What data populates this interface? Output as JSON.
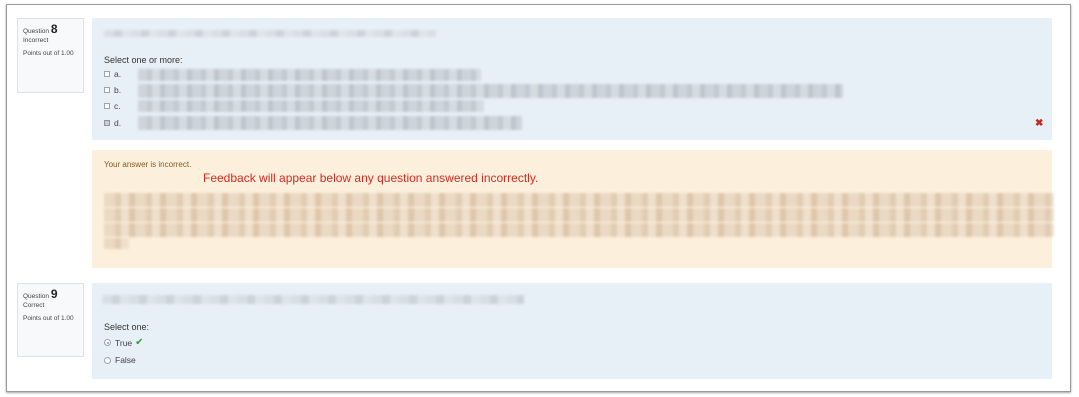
{
  "questions": [
    {
      "number_label": "Question",
      "number": "8",
      "status": "Incorrect",
      "points": "Points out of 1.00",
      "prompt": "Select one or more:",
      "options": [
        {
          "letter": "a.",
          "checked": false
        },
        {
          "letter": "b.",
          "checked": false
        },
        {
          "letter": "c.",
          "checked": false
        },
        {
          "letter": "d.",
          "checked": true
        }
      ],
      "result_icon": "x-icon",
      "feedback": {
        "heading": "Your answer is incorrect.",
        "note": "Feedback will appear below any question answered incorrectly."
      }
    },
    {
      "number_label": "Question",
      "number": "9",
      "status": "Correct",
      "points": "Points out of 1.00",
      "prompt": "Select one:",
      "options": [
        {
          "label": "True",
          "checked": true,
          "mark": "✔"
        },
        {
          "label": "False",
          "checked": false
        }
      ]
    }
  ],
  "colors": {
    "question_bg": "#e7f0f6",
    "feedback_bg": "#fcefdc",
    "incorrect": "#c62828",
    "correct": "#3c9a3c",
    "note_text": "#d62b1f"
  }
}
